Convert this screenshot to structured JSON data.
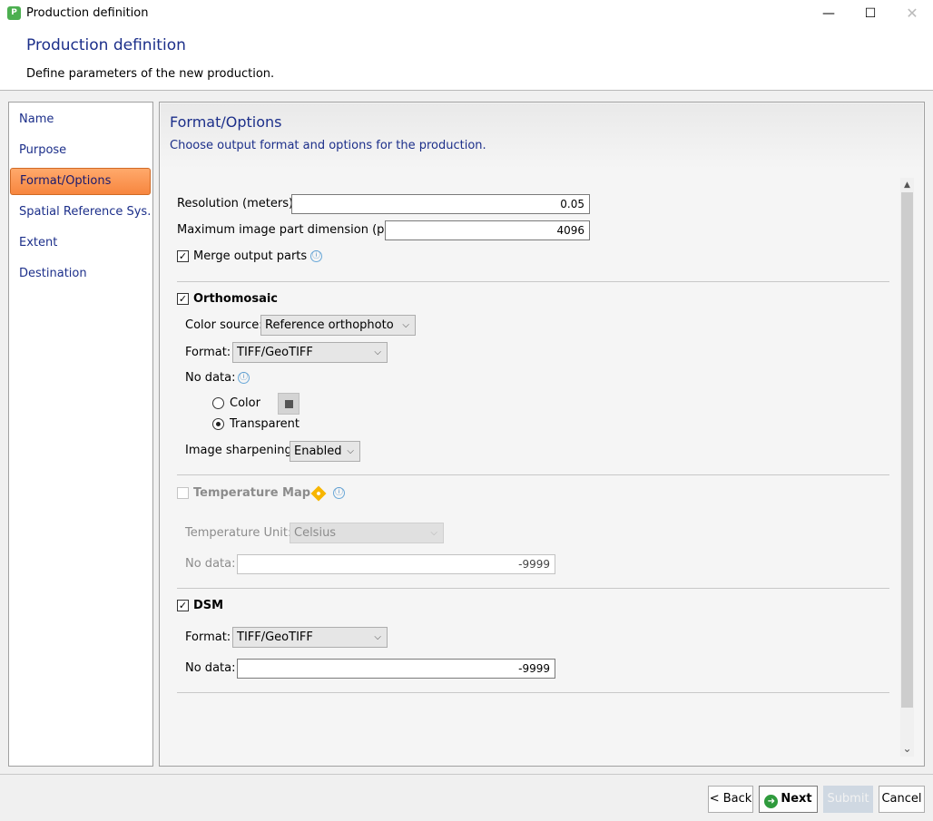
{
  "window": {
    "title": "Production definition",
    "app_icon": "pix4d-app-icon",
    "minimize": "—",
    "maximize": "☐",
    "close": "✕"
  },
  "header": {
    "title": "Production definition",
    "subtitle": "Define parameters of the new production."
  },
  "sidebar": {
    "items": [
      {
        "label": "Name"
      },
      {
        "label": "Purpose"
      },
      {
        "label": "Format/Options",
        "active": true
      },
      {
        "label": "Spatial Reference Sys..."
      },
      {
        "label": "Extent"
      },
      {
        "label": "Destination"
      }
    ]
  },
  "panel": {
    "title": "Format/Options",
    "subtitle": "Choose output format and options for the production."
  },
  "general": {
    "resolution_label": "Resolution (meters):",
    "resolution_value": "0.05",
    "max_dim_label": "Maximum image part dimension (px):",
    "max_dim_value": "4096",
    "merge_label": "Merge output parts",
    "merge_checked": true
  },
  "orthomosaic": {
    "label": "Orthomosaic",
    "checked": true,
    "color_source_label": "Color source:",
    "color_source_value": "Reference orthophoto",
    "format_label": "Format:",
    "format_value": "TIFF/GeoTIFF",
    "nodata_label": "No data:",
    "radio_color_label": "Color",
    "radio_transparent_label": "Transparent",
    "selected_nodata": "Transparent",
    "sharpening_label": "Image sharpening:",
    "sharpening_value": "Enabled"
  },
  "temperature_map": {
    "label": "Temperature Map",
    "checked": false,
    "enabled": false,
    "unit_label": "Temperature Unit:",
    "unit_value": "Celsius",
    "nodata_label": "No data:",
    "nodata_value": "-9999"
  },
  "dsm": {
    "label": "DSM",
    "checked": true,
    "format_label": "Format:",
    "format_value": "TIFF/GeoTIFF",
    "nodata_label": "No data:",
    "nodata_value": "-9999"
  },
  "footer": {
    "back_label": "< Back",
    "next_label": "Next",
    "submit_label": "Submit",
    "cancel_label": "Cancel"
  },
  "icons": {
    "info": "ⓘ",
    "check": "✓",
    "dropdown": "⌵",
    "scroll_up": "▲",
    "scroll_down": "⌄"
  },
  "colors": {
    "accent_blue": "#1c2f8a",
    "active_nav": "#f7863f",
    "next_icon": "#2e9a3c",
    "warning_diamond": "#f7b500"
  }
}
